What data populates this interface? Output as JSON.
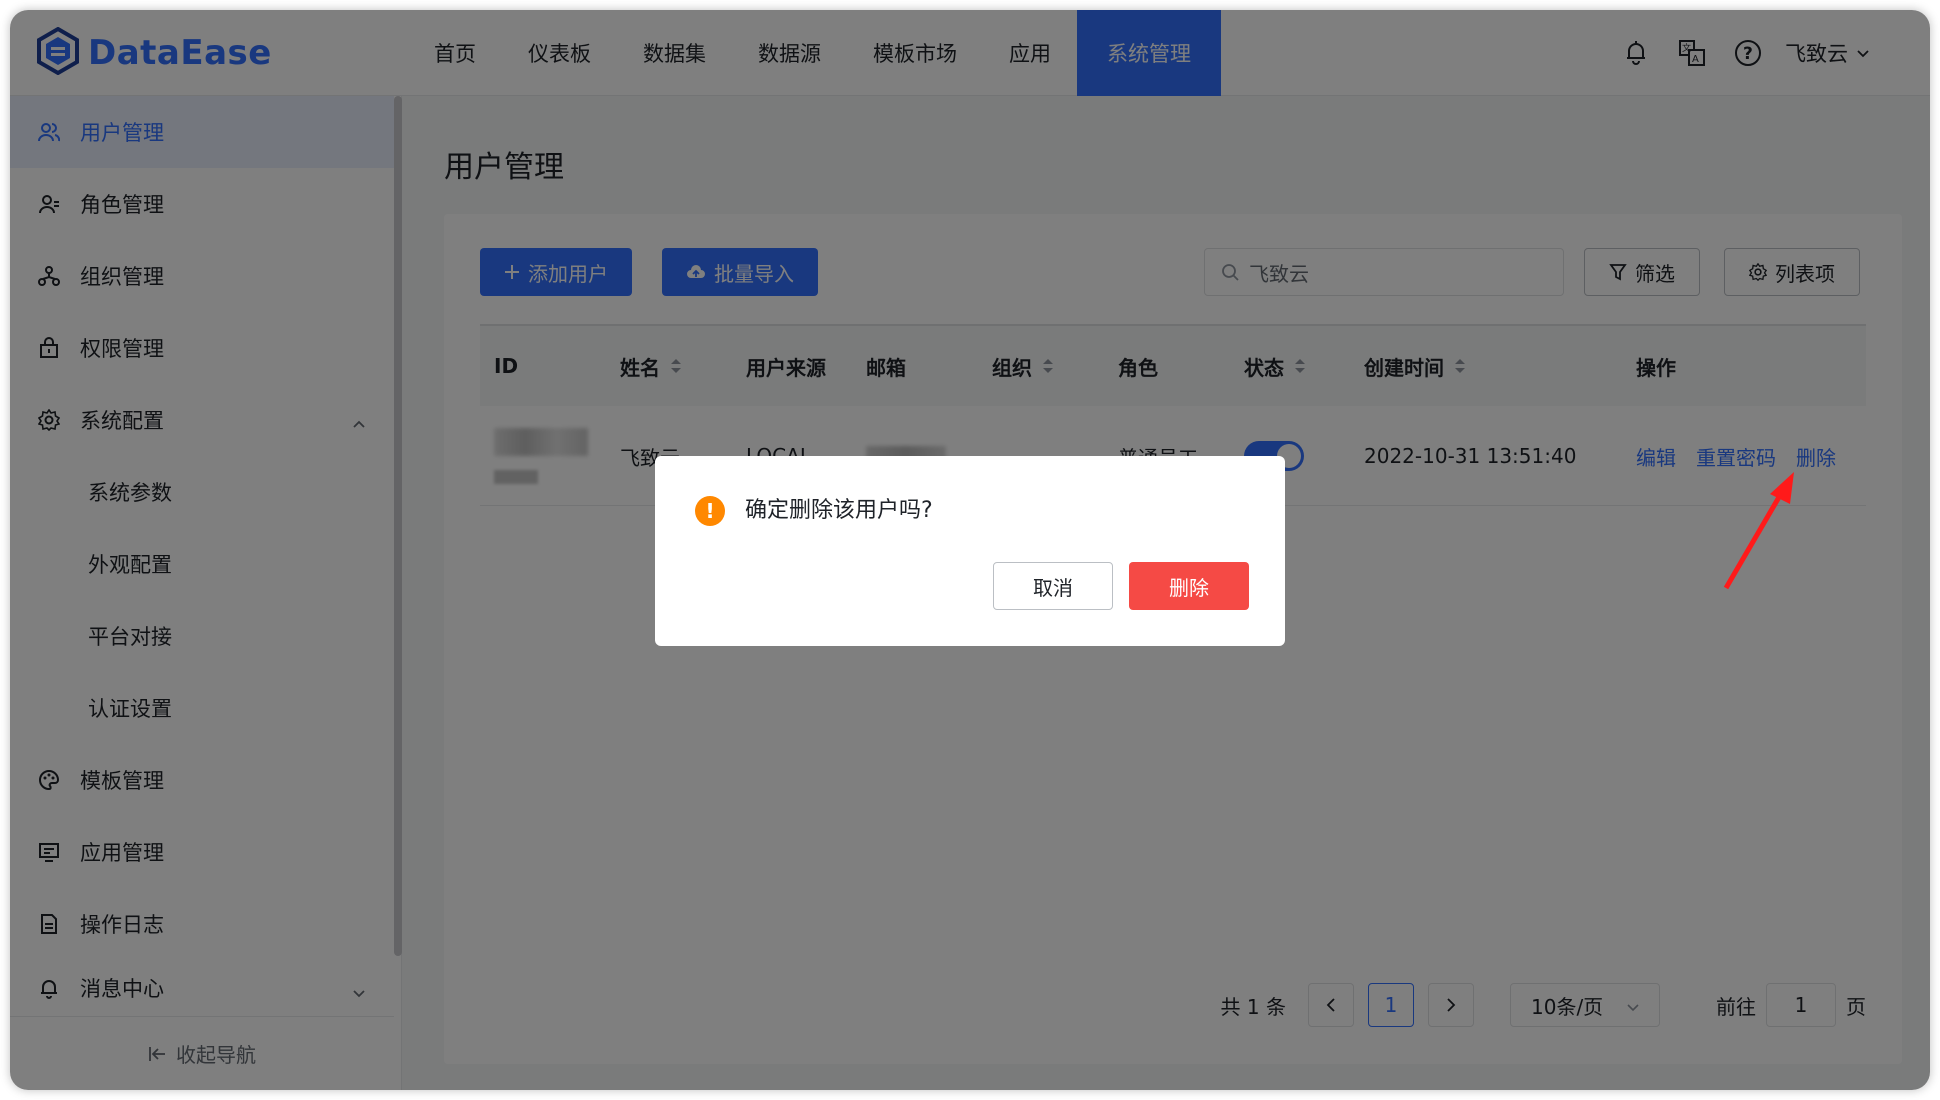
{
  "app": {
    "logo_text": "DataEase"
  },
  "nav": {
    "items": [
      "首页",
      "仪表板",
      "数据集",
      "数据源",
      "模板市场",
      "应用",
      "系统管理"
    ],
    "active_index": 6
  },
  "header": {
    "user_name": "飞致云"
  },
  "sidebar": {
    "items": [
      {
        "label": "用户管理",
        "icon": "user-group-icon"
      },
      {
        "label": "角色管理",
        "icon": "user-role-icon"
      },
      {
        "label": "组织管理",
        "icon": "org-tree-icon"
      },
      {
        "label": "权限管理",
        "icon": "lock-icon"
      },
      {
        "label": "系统配置",
        "icon": "gear-icon"
      },
      {
        "label": "系统参数"
      },
      {
        "label": "外观配置"
      },
      {
        "label": "平台对接"
      },
      {
        "label": "认证设置"
      },
      {
        "label": "模板管理",
        "icon": "palette-icon"
      },
      {
        "label": "应用管理",
        "icon": "app-monitor-icon"
      },
      {
        "label": "操作日志",
        "icon": "log-icon"
      },
      {
        "label": "消息中心",
        "icon": "bell-icon"
      }
    ],
    "collapse_label": "收起导航"
  },
  "page": {
    "title": "用户管理"
  },
  "toolbar": {
    "add_user": "添加用户",
    "batch_import": "批量导入",
    "search_value": "飞致云",
    "filter": "筛选",
    "columns": "列表项"
  },
  "table": {
    "headers": {
      "id": "ID",
      "name": "姓名",
      "source": "用户来源",
      "email": "邮箱",
      "org": "组织",
      "role": "角色",
      "status": "状态",
      "created": "创建时间",
      "ops": "操作"
    },
    "rows": [
      {
        "name": "飞致云",
        "source": "LOCAL",
        "org": "-",
        "role": "普通员工",
        "status_on": true,
        "created": "2022-10-31 13:51:40",
        "ops": {
          "edit": "编辑",
          "reset": "重置密码",
          "delete": "删除"
        }
      }
    ]
  },
  "pagination": {
    "total": "共 1 条",
    "current_page": "1",
    "page_size": "10条/页",
    "goto_label": "前往",
    "goto_value": "1",
    "page_suffix": "页"
  },
  "dialog": {
    "message": "确定删除该用户吗?",
    "cancel": "取消",
    "confirm": "删除",
    "warning_color": "#ff8800",
    "danger_color": "#f54a45"
  },
  "colors": {
    "accent": "#3370ff"
  }
}
